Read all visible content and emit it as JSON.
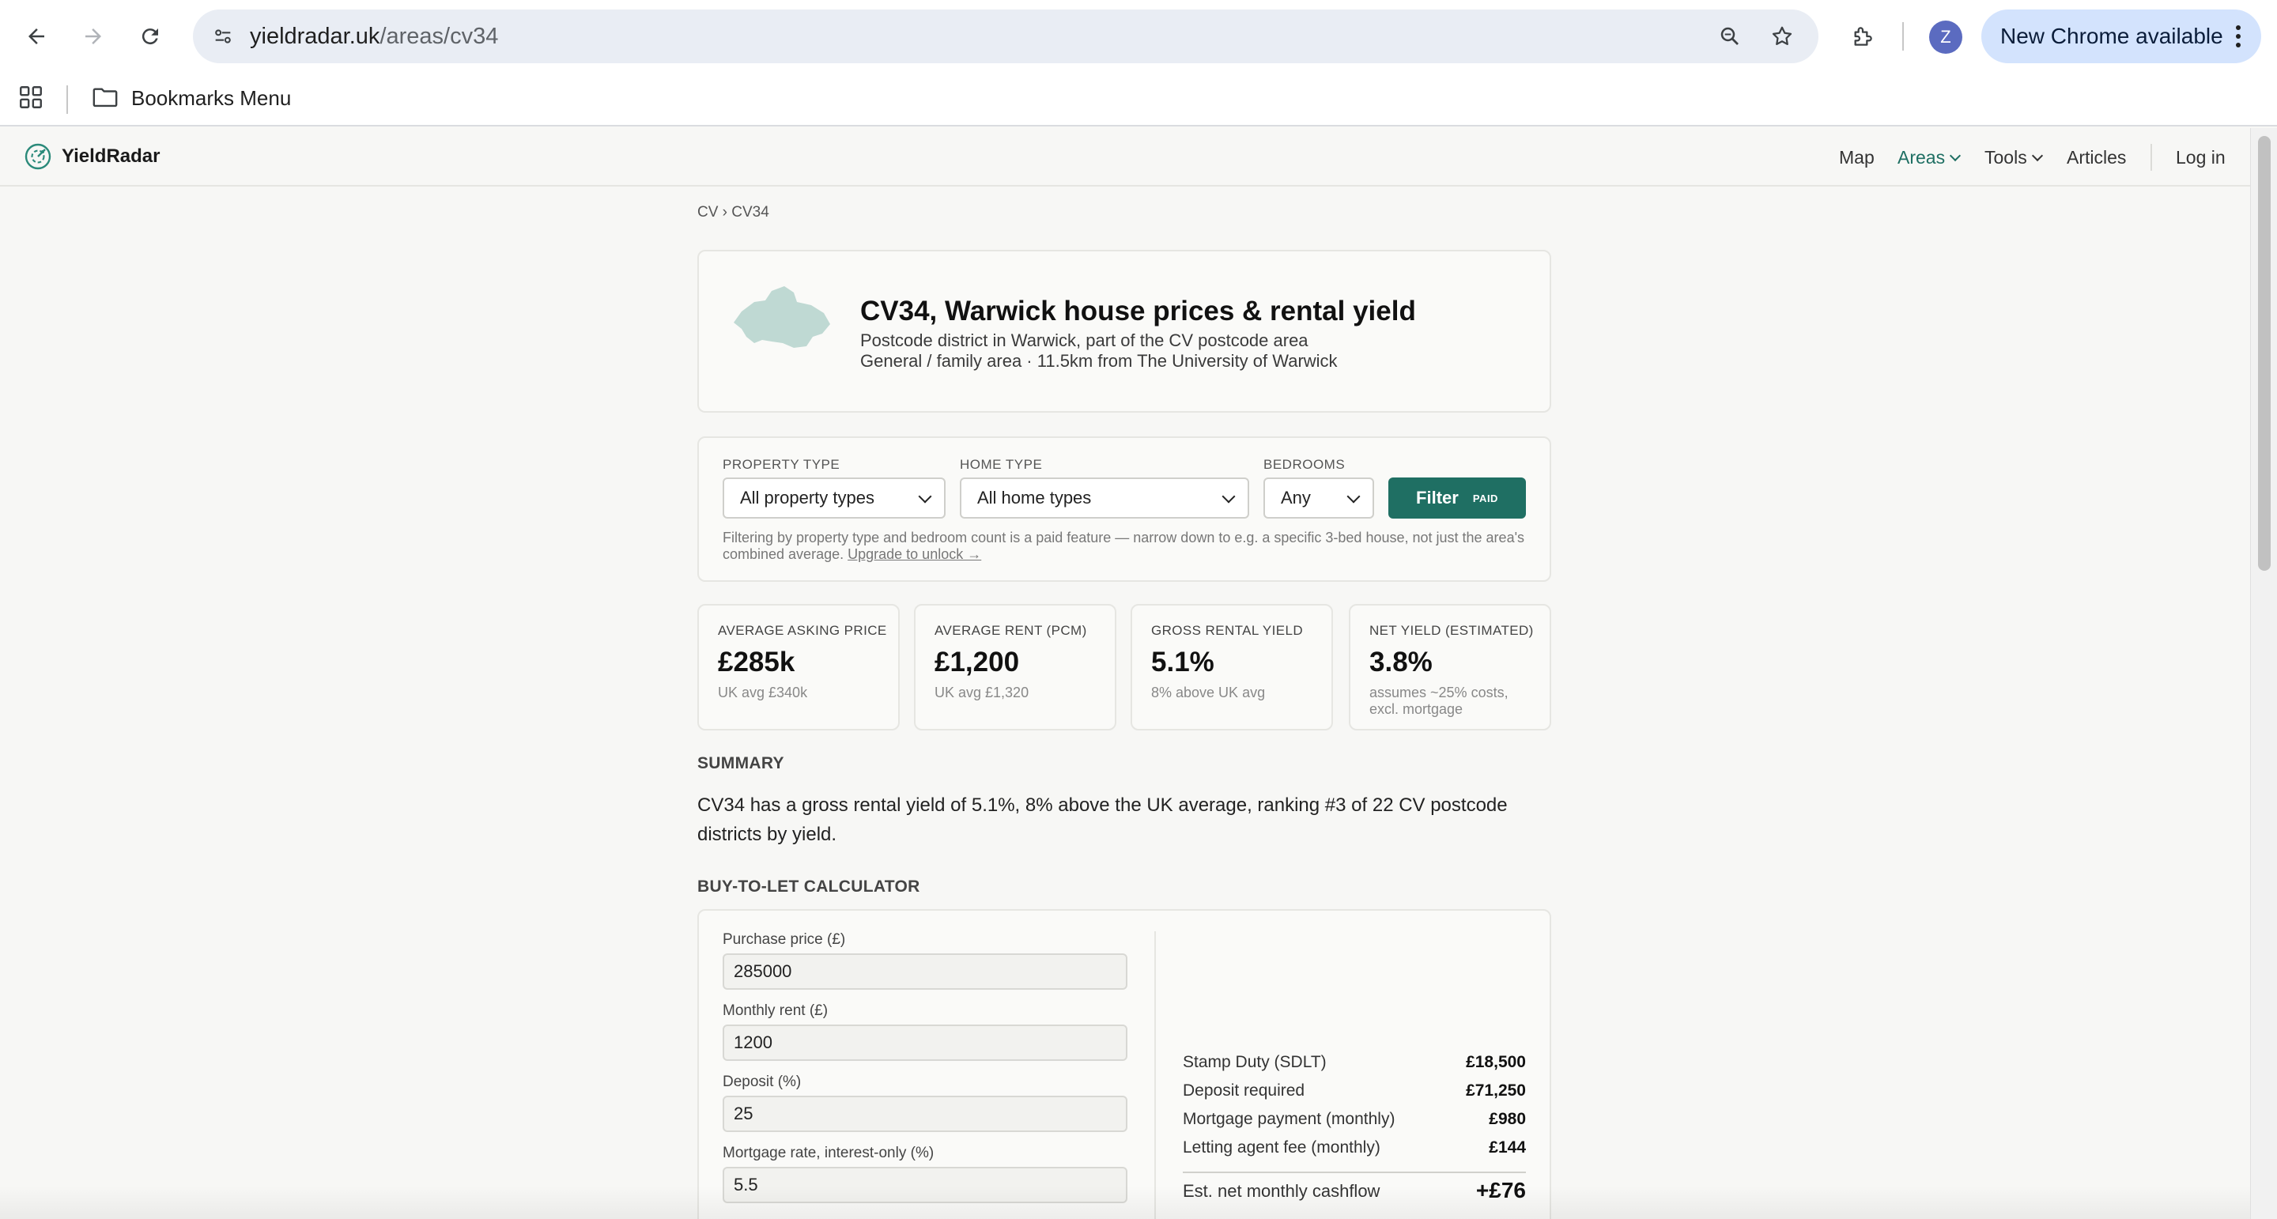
{
  "browser": {
    "url_host": "yieldradar.uk",
    "url_path": "/areas/cv34",
    "profile_initial": "Z",
    "update_label": "New Chrome available",
    "bookmarks_folder": "Bookmarks Menu",
    "icons": [
      "back-icon",
      "forward-icon",
      "reload-icon",
      "site-info-icon",
      "zoom-icon",
      "star-icon",
      "extensions-icon",
      "apps-icon",
      "folder-icon",
      "kebab-icon"
    ]
  },
  "site": {
    "brand": "YieldRadar",
    "nav": {
      "map": "Map",
      "areas": "Areas",
      "tools": "Tools",
      "articles": "Articles",
      "login": "Log in"
    },
    "accent": "#1f6f63"
  },
  "breadcrumb": "CV › CV34",
  "hero": {
    "title": "CV34, Warwick house prices & rental yield",
    "subtitle1": "Postcode district in Warwick, part of the CV postcode area",
    "subtitle2": "General / family area · 11.5km from The University of Warwick"
  },
  "filters": {
    "property_type_label": "PROPERTY TYPE",
    "property_type_value": "All property types",
    "home_type_label": "HOME TYPE",
    "home_type_value": "All home types",
    "bedrooms_label": "BEDROOMS",
    "bedrooms_value": "Any",
    "filter_button": "Filter",
    "paid_badge": "PAID",
    "note": "Filtering by property type and bedroom count is a paid feature — narrow down to e.g. a specific 3-bed house, not just the area's combined average.",
    "upgrade_link": "Upgrade to unlock →"
  },
  "stats": [
    {
      "label": "AVERAGE ASKING PRICE",
      "value": "£285k",
      "note": "UK avg £340k"
    },
    {
      "label": "AVERAGE RENT (PCM)",
      "value": "£1,200",
      "note": "UK avg £1,320"
    },
    {
      "label": "GROSS RENTAL YIELD",
      "value": "5.1%",
      "note": "8% above UK avg"
    },
    {
      "label": "NET YIELD (ESTIMATED)",
      "value": "3.8%",
      "note": "assumes ~25% costs, excl. mortgage"
    }
  ],
  "summary": {
    "heading": "SUMMARY",
    "text": "CV34 has a gross rental yield of 5.1%, 8% above the UK average, ranking #3 of 22 CV postcode districts by yield."
  },
  "calculator": {
    "heading": "BUY-TO-LET CALCULATOR",
    "inputs": [
      {
        "label": "Purchase price (£)",
        "value": "285000"
      },
      {
        "label": "Monthly rent (£)",
        "value": "1200"
      },
      {
        "label": "Deposit (%)",
        "value": "25"
      },
      {
        "label": "Mortgage rate, interest-only (%)",
        "value": "5.5"
      }
    ],
    "results": [
      {
        "label": "Stamp Duty (SDLT)",
        "value": "£18,500"
      },
      {
        "label": "Deposit required",
        "value": "£71,250"
      },
      {
        "label": "Mortgage payment (monthly)",
        "value": "£980"
      },
      {
        "label": "Letting agent fee (monthly)",
        "value": "£144"
      }
    ],
    "cashflow_label": "Est. net monthly cashflow",
    "cashflow_value": "+£76"
  }
}
